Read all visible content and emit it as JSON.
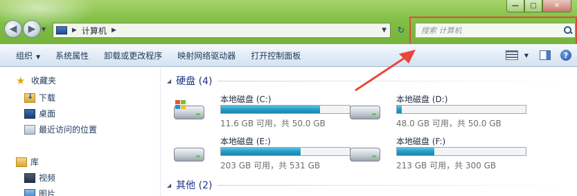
{
  "window": {
    "minimize_label": "—",
    "maximize_label": "□",
    "close_label": "✕"
  },
  "nav": {
    "back_glyph": "◀",
    "forward_glyph": "▶",
    "address_text": "计算机",
    "refresh_glyph": "↻"
  },
  "search": {
    "placeholder": "搜索 计算机"
  },
  "toolbar": {
    "items": [
      "组织",
      "系统属性",
      "卸载或更改程序",
      "映射网络驱动器",
      "打开控制面板"
    ],
    "help_label": "?"
  },
  "sidebar": {
    "favorites": "收藏夹",
    "fav_items": [
      "下载",
      "桌面",
      "最近访问的位置"
    ],
    "libraries": "库",
    "lib_items": [
      "视频",
      "图片"
    ]
  },
  "content": {
    "section_drives": "硬盘 (4)",
    "section_other": "其他 (2)",
    "drives": [
      {
        "name": "本地磁盘 (C:)",
        "free": "11.6 GB 可用，共 50.0 GB",
        "used_fraction": 0.77,
        "system": true
      },
      {
        "name": "本地磁盘 (D:)",
        "free": "48.0 GB 可用，共 50.0 GB",
        "used_fraction": 0.04,
        "system": false
      },
      {
        "name": "本地磁盘 (E:)",
        "free": "203 GB 可用，共 531 GB",
        "used_fraction": 0.62,
        "system": false
      },
      {
        "name": "本地磁盘 (F:)",
        "free": "213 GB 可用，共 300 GB",
        "used_fraction": 0.29,
        "system": false
      }
    ]
  },
  "colors": {
    "frame_green": "#86c24a",
    "highlight_red": "#e8473a",
    "bar_blue": "#26a0c9"
  }
}
